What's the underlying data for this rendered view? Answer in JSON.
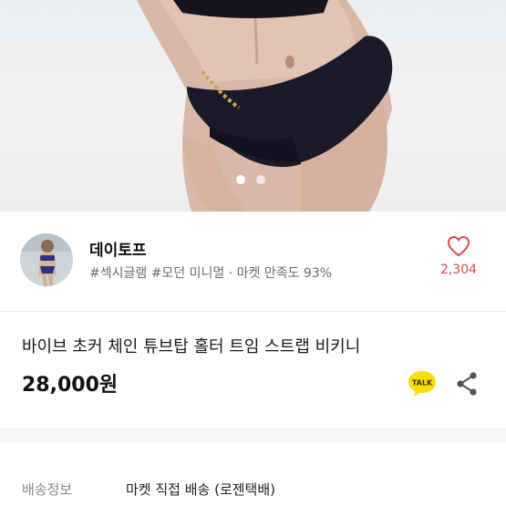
{
  "gallery": {
    "image_subject": "swimwear-bottom-with-chain",
    "page_count": 2,
    "active_index": 0
  },
  "shop": {
    "name": "데이토프",
    "tags": "#섹시글램 #모던 미니멀 · 마켓 만족도 93%",
    "like_count": "2,304",
    "like_icon": "heart-outline-icon",
    "accent_color": "#d94a54"
  },
  "product": {
    "title": "바이브 초커 체인 튜브탑 홀터 트임 스트랩 비키니",
    "price": "28,000원"
  },
  "actions": {
    "talk_label": "TALK",
    "talk_color": "#3b2e1e",
    "talk_bg": "#f9e000",
    "share_icon": "share-icon"
  },
  "shipping": {
    "label": "배송정보",
    "value": "마켓 직접 배송 (로젠택배)"
  }
}
